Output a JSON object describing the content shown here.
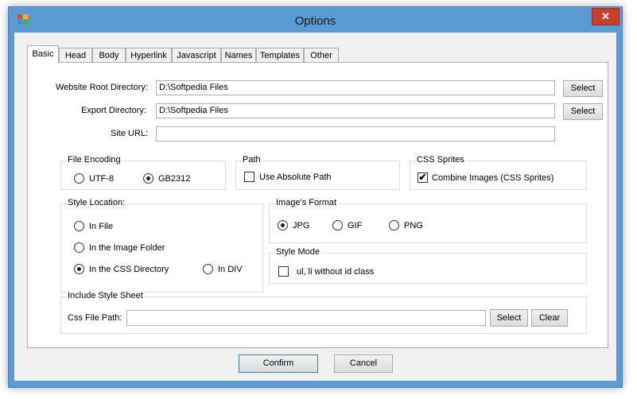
{
  "window": {
    "title": "Options",
    "close_label": "✕",
    "icon_colors": [
      "#e04b2c",
      "#f7b500",
      "#3c8fd6",
      "#48b04a"
    ]
  },
  "tabs": [
    {
      "label": "Basic",
      "active": true
    },
    {
      "label": "Head"
    },
    {
      "label": "Body"
    },
    {
      "label": "Hyperlink"
    },
    {
      "label": "Javascript"
    },
    {
      "label": "Names"
    },
    {
      "label": "Templates"
    },
    {
      "label": "Other"
    }
  ],
  "fields": {
    "website_root": {
      "label": "Website Root Directory:",
      "value": "D:\\Softpedia Files",
      "button": "Select"
    },
    "export_dir": {
      "label": "Export Directory:",
      "value": "D:\\Softpedia Files",
      "button": "Select"
    },
    "site_url": {
      "label": "Site URL:",
      "value": ""
    }
  },
  "file_encoding": {
    "title": "File Encoding",
    "options": [
      {
        "label": "UTF-8",
        "selected": false
      },
      {
        "label": "GB2312",
        "selected": true
      }
    ]
  },
  "path": {
    "title": "Path",
    "use_absolute": {
      "label": "Use Absolute Path",
      "checked": false
    }
  },
  "css_sprites": {
    "title": "CSS Sprites",
    "combine": {
      "label": "Combine Images (CSS Sprites)",
      "checked": true
    }
  },
  "style_location": {
    "title": "Style Location:",
    "options": [
      {
        "label": "In File",
        "selected": false
      },
      {
        "label": "In the Image Folder",
        "selected": false
      },
      {
        "label": "In the CSS Directory",
        "selected": true
      },
      {
        "label": "In DIV",
        "selected": false
      }
    ]
  },
  "image_format": {
    "title": "Image's Format",
    "options": [
      {
        "label": "JPG",
        "selected": true
      },
      {
        "label": "GIF",
        "selected": false
      },
      {
        "label": "PNG",
        "selected": false
      }
    ]
  },
  "style_mode": {
    "title": "Style Mode",
    "option": {
      "label": "ul, li without id  class",
      "checked": false
    }
  },
  "include_stylesheet": {
    "title": "Include Style Sheet",
    "label": "Css File Path:",
    "value": "",
    "select_label": "Select",
    "clear_label": "Clear"
  },
  "footer": {
    "confirm": "Confirm",
    "cancel": "Cancel"
  }
}
